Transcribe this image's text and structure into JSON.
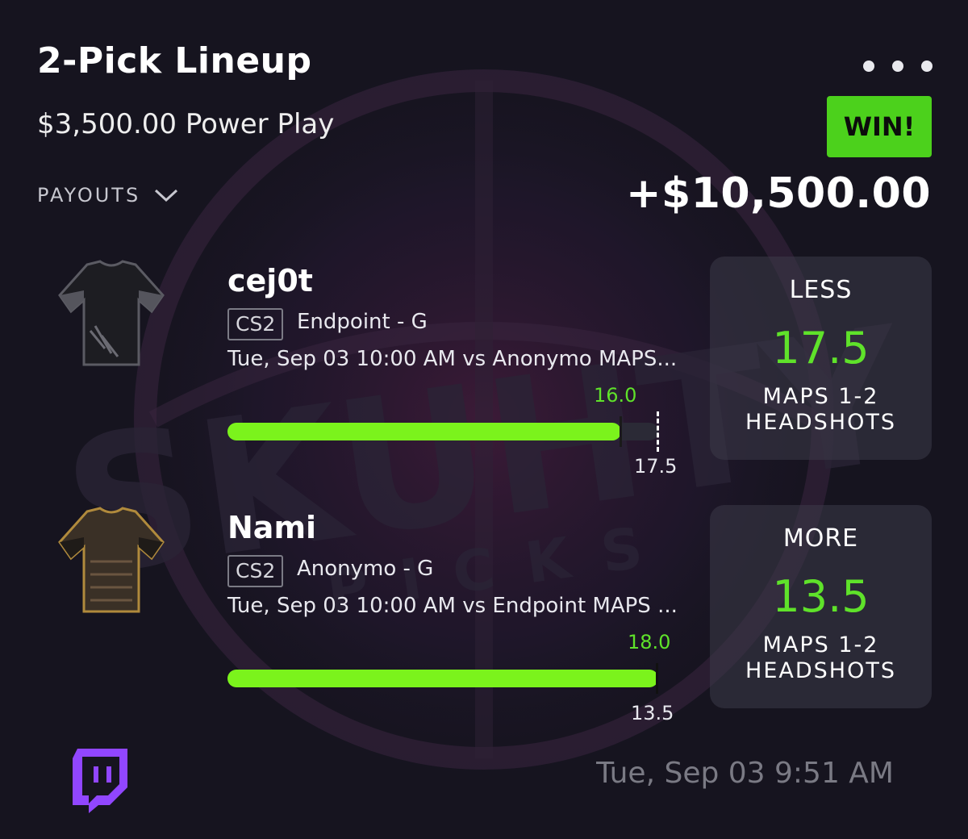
{
  "header": {
    "title": "2-Pick Lineup",
    "entry": "$3,500.00 Power Play",
    "payouts_label": "PAYOUTS",
    "result_badge": "WIN!",
    "payout_amount": "+$10,500.00"
  },
  "picks": [
    {
      "player": "cej0t",
      "game": "CS2",
      "team": "Endpoint - G",
      "match": "Tue, Sep 03 10:00 AM  vs Anonymo MAPS...",
      "actual": "16.0",
      "line": "17.5",
      "actual_fraction": 0.914,
      "direction": "LESS",
      "value": "17.5",
      "stat_line1": "MAPS 1-2",
      "stat_line2": "HEADSHOTS",
      "jersey_icon": "jersey-black-icon"
    },
    {
      "player": "Nami",
      "game": "CS2",
      "team": "Anonymo - G",
      "match": "Tue, Sep 03 10:00 AM  vs Endpoint MAPS ...",
      "actual": "18.0",
      "line": "13.5",
      "actual_fraction": 1.0,
      "direction": "MORE",
      "value": "13.5",
      "stat_line1": "MAPS 1-2",
      "stat_line2": "HEADSHOTS",
      "jersey_icon": "jersey-gold-icon"
    }
  ],
  "footer": {
    "timestamp": "Tue, Sep 03 9:51 AM",
    "twitch_icon": "twitch-icon"
  },
  "watermark": {
    "brand_text": "SKUHTY",
    "sub_text": "PICKS"
  },
  "colors": {
    "win_green": "#4cd11c",
    "bar_green": "#7bf31c",
    "value_green": "#5fe22a",
    "twitch_purple": "#9146ff",
    "background": "#16141f"
  }
}
